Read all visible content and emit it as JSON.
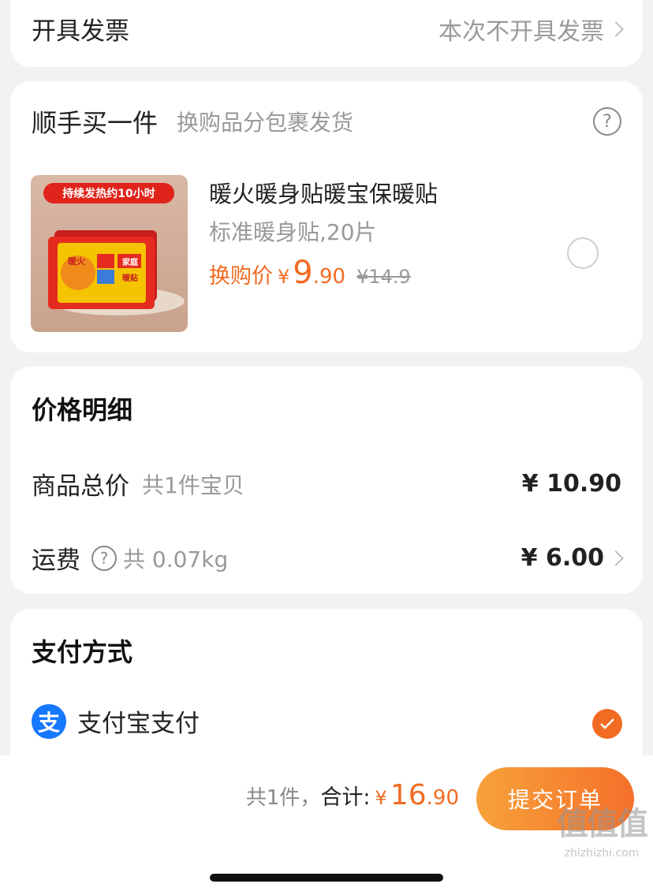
{
  "invoice": {
    "label": "开具发票",
    "value": "本次不开具发票"
  },
  "addon": {
    "title": "顺手买一件",
    "subtitle": "换购品分包裹发货",
    "help_icon": "?",
    "product": {
      "image_banner": "持续发热约10小时",
      "image_labels": [
        "暖火",
        "家庭",
        "暖贴"
      ],
      "name": "暖火暖身贴暖宝保暖贴",
      "spec": "标准暖身贴,20片",
      "price_label": "换购价",
      "currency": "¥",
      "price_int": "9",
      "price_dec": ".90",
      "original_price": "¥14.9",
      "selected": false
    }
  },
  "price_detail": {
    "title": "价格明细",
    "goods_label": "商品总价",
    "goods_note": "共1件宝贝",
    "goods_amount": "¥ 10.90",
    "shipping_label": "运费",
    "shipping_help": "?",
    "shipping_note": "共 0.07kg",
    "shipping_amount": "¥ 6.00"
  },
  "payment": {
    "title": "支付方式",
    "method_icon": "支",
    "method_label": "支付宝支付",
    "selected": true
  },
  "bottom": {
    "count": "共1件，",
    "total_label": "合计:",
    "currency": "¥",
    "total_int": "16",
    "total_dec": ".90",
    "submit_label": "提交订单",
    "watermark_text": "zhizhizhi.com",
    "watermark_logo": "值值值"
  },
  "colors": {
    "accent": "#f26b22",
    "alipay": "#1677ff"
  }
}
